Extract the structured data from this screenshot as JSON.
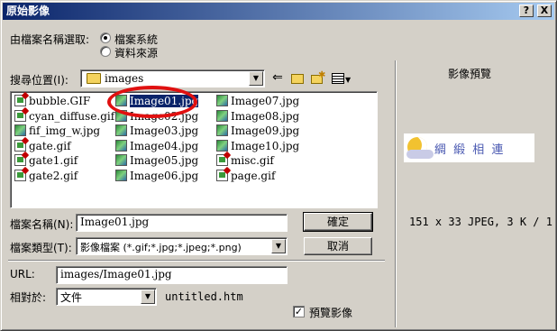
{
  "window": {
    "title": "原始影像",
    "help_label": "?",
    "close_label": "X"
  },
  "source": {
    "label": "由檔案名稱選取:",
    "option_file": "檔案系統",
    "option_data": "資料來源"
  },
  "lookin": {
    "label": "搜尋位置(I):",
    "folder": "images"
  },
  "files": [
    {
      "name": "bubble.GIF",
      "type": "gif"
    },
    {
      "name": "cyan_diffuse.gif",
      "type": "gif"
    },
    {
      "name": "fif_img_w.jpg",
      "type": "jpg"
    },
    {
      "name": "gate.gif",
      "type": "gif"
    },
    {
      "name": "gate1.gif",
      "type": "gif"
    },
    {
      "name": "gate2.gif",
      "type": "gif"
    },
    {
      "name": "Image01.jpg",
      "type": "jpg"
    },
    {
      "name": "Image02.jpg",
      "type": "jpg"
    },
    {
      "name": "Image03.jpg",
      "type": "jpg"
    },
    {
      "name": "Image04.jpg",
      "type": "jpg"
    },
    {
      "name": "Image05.jpg",
      "type": "jpg"
    },
    {
      "name": "Image06.jpg",
      "type": "jpg"
    },
    {
      "name": "Image07.jpg",
      "type": "jpg"
    },
    {
      "name": "Image08.jpg",
      "type": "jpg"
    },
    {
      "name": "Image09.jpg",
      "type": "jpg"
    },
    {
      "name": "Image10.jpg",
      "type": "jpg"
    },
    {
      "name": "misc.gif",
      "type": "gif"
    },
    {
      "name": "page.gif",
      "type": "gif"
    }
  ],
  "selected_file": "Image01.jpg",
  "filename": {
    "label": "檔案名稱(N):",
    "value": "Image01.jpg"
  },
  "filetype": {
    "label": "檔案類型(T):",
    "value": "影像檔案 (*.gif;*.jpg;*.jpeg;*.png)"
  },
  "buttons": {
    "ok": "確定",
    "cancel": "取消"
  },
  "url": {
    "label": "URL:",
    "value": "images/Image01.jpg"
  },
  "relative": {
    "label": "相對於:",
    "value": "文件",
    "doc": "untitled.htm"
  },
  "preview": {
    "title": "影像預覽",
    "image_text": "綢 緞 相 連",
    "info": "151 x 33 JPEG, 3 K / 1",
    "checkbox_label": "預覽影像",
    "checked": true
  },
  "colors": {
    "titlebar_start": "#0a246a",
    "titlebar_end": "#a6caf0",
    "selection": "#0a246a",
    "highlight_circle": "#e01010"
  }
}
